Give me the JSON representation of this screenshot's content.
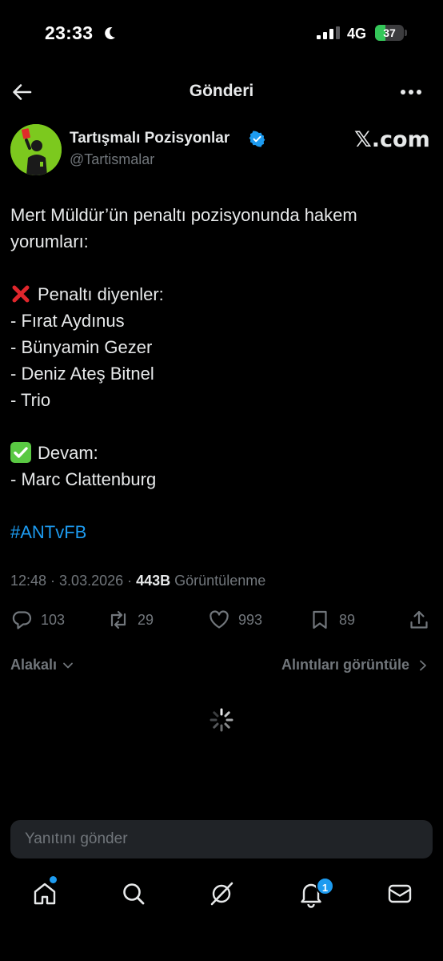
{
  "status_bar": {
    "time": "23:33",
    "network": "4G",
    "battery": "37",
    "battery_level": 0.37
  },
  "header": {
    "title": "Gönderi"
  },
  "author": {
    "name": "Tartışmalı Pozisyonlar",
    "handle": "@Tartismalar",
    "source_label": "𝕏.com"
  },
  "post": {
    "lines": [
      "Mert Müldür’ün penaltı pozisyonunda hakem",
      "yorumları:",
      "",
      "Penaltı diyenler:",
      "- Fırat Aydınus",
      "- Bünyamin Gezer",
      "- Deniz Ateş Bitnel",
      "- Trio",
      "",
      "Devam:",
      "- Marc Clattenburg",
      "",
      "#ANTvFB"
    ]
  },
  "meta": {
    "time_date": "12:48 · 3.03.2026 · ",
    "views": "443B",
    "views_label": " Görüntülenme"
  },
  "actions": {
    "replies": "103",
    "reposts": "29",
    "likes": "993",
    "bookmarks": "89"
  },
  "replies_section": {
    "sort_label": "Alakalı",
    "quotes_label": "Alıntıları görüntüle"
  },
  "reply_box": {
    "placeholder": "Yanıtını gönder"
  },
  "tab_bar": {
    "notification_count": "1"
  },
  "colors": {
    "accent": "#1d9bf0",
    "background": "#000000",
    "text": "#e7e9ea",
    "muted": "#71767b",
    "battery": "#34c759",
    "cross": "#e0262c",
    "check": "#5ac943"
  }
}
